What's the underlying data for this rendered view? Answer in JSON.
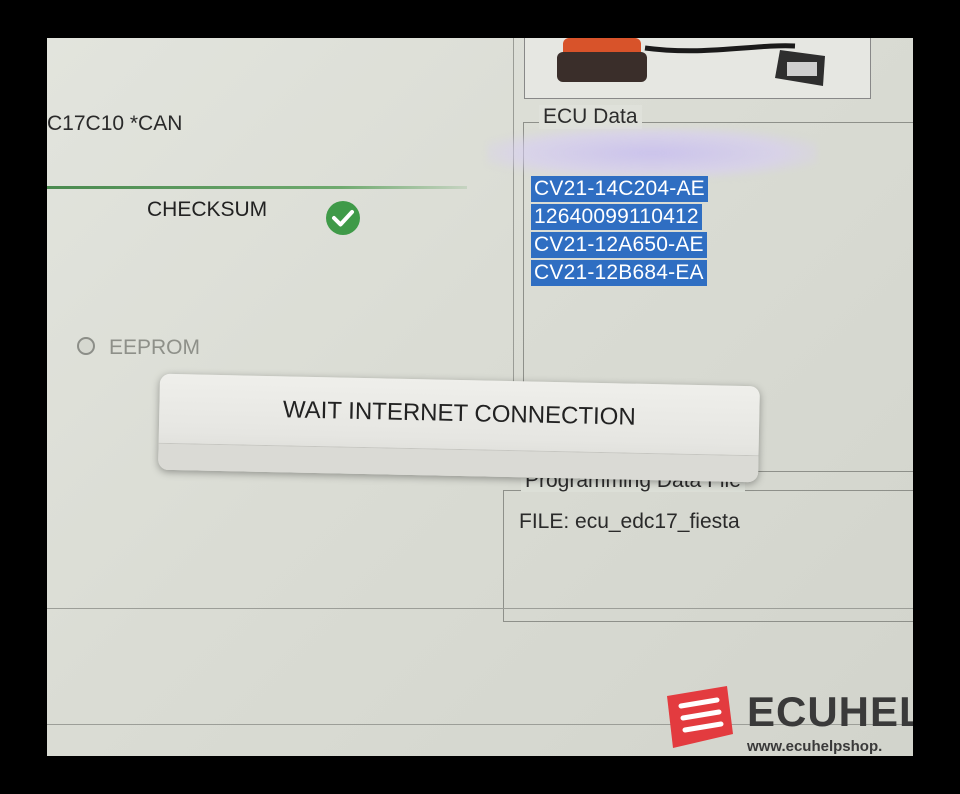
{
  "app": {
    "ecu_model": "C17C10 *CAN",
    "checksum_label": "CHECKSUM",
    "eeprom_label": "EEPROM"
  },
  "ecu_data": {
    "legend": "ECU Data",
    "lines": [
      "CV21-14C204-AE",
      "12640099110412",
      "CV21-12A650-AE",
      "CV21-12B684-EA"
    ]
  },
  "programming": {
    "legend": "Programming Data File",
    "file_label": "FILE: ecu_edc17_fiesta"
  },
  "dialog": {
    "message": "WAIT INTERNET CONNECTION"
  },
  "watermark": {
    "brand": "ECUHEL",
    "url": "www.ecuhelpshop."
  },
  "colors": {
    "selection": "#2f6ec2",
    "checksum_ok": "#3f9a48",
    "watermark_red": "#e33b3f"
  }
}
